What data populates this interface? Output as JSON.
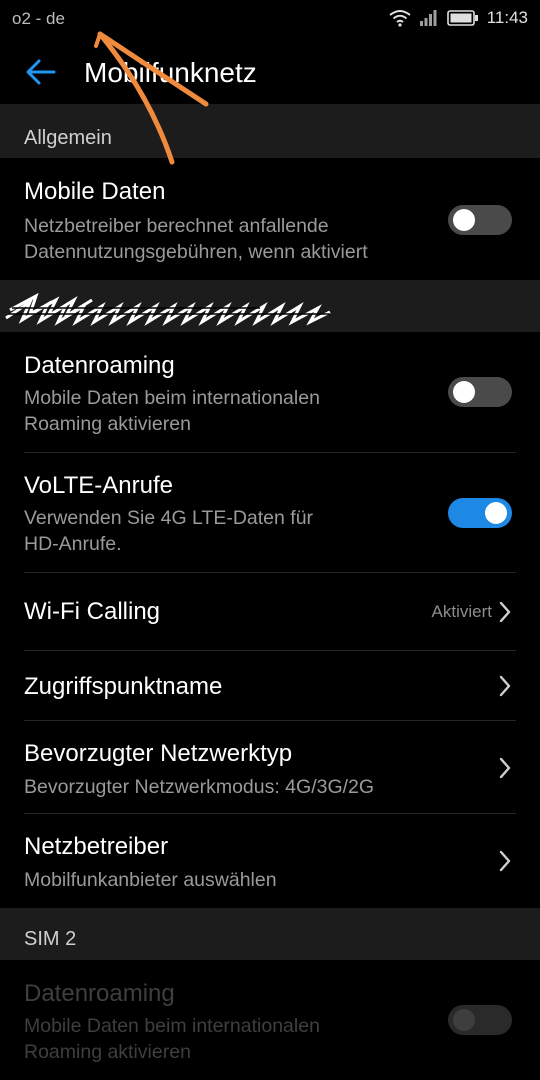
{
  "status_bar": {
    "carrier": "o2 - de",
    "time": "11:43",
    "icons": [
      "wifi-icon",
      "signal-icon",
      "battery-icon"
    ]
  },
  "app_bar": {
    "title": "Mobilfunknetz",
    "back_icon": "back-arrow-icon"
  },
  "sections": {
    "general": "Allgemein",
    "sim2": "SIM 2"
  },
  "rows": {
    "mobile_data": {
      "title": "Mobile Daten",
      "subtitle_line1": "Netzbetreiber berechnet anfallende",
      "subtitle_line2": "Datennutzungsgebühren, wenn aktiviert",
      "toggle_on": false
    },
    "roaming": {
      "title": "Datenroaming",
      "subtitle_line1": "Mobile Daten beim internationalen",
      "subtitle_line2": "Roaming aktivieren",
      "toggle_on": false
    },
    "volte": {
      "title": "VoLTE-Anrufe",
      "subtitle_line1": "Verwenden Sie 4G LTE-Daten für",
      "subtitle_line2": "HD-Anrufe.",
      "toggle_on": true
    },
    "wifi_calling": {
      "title": "Wi-Fi Calling",
      "value": "Aktiviert"
    },
    "apn": {
      "title": "Zugriffspunktname"
    },
    "network_type": {
      "title": "Bevorzugter Netzwerktyp",
      "subtitle": "Bevorzugter Netzwerkmodus: 4G/3G/2G"
    },
    "operator": {
      "title": "Netzbetreiber",
      "subtitle": "Mobilfunkanbieter auswählen"
    },
    "sim2_roaming": {
      "title": "Datenroaming",
      "subtitle_line1": "Mobile Daten beim internationalen",
      "subtitle_line2": "Roaming aktivieren",
      "toggle_on": false,
      "enabled": false
    }
  },
  "colors": {
    "background": "#000000",
    "section_background": "#1c1c1c",
    "accent": "#1e88e5",
    "annotation": "#f08a3c"
  }
}
